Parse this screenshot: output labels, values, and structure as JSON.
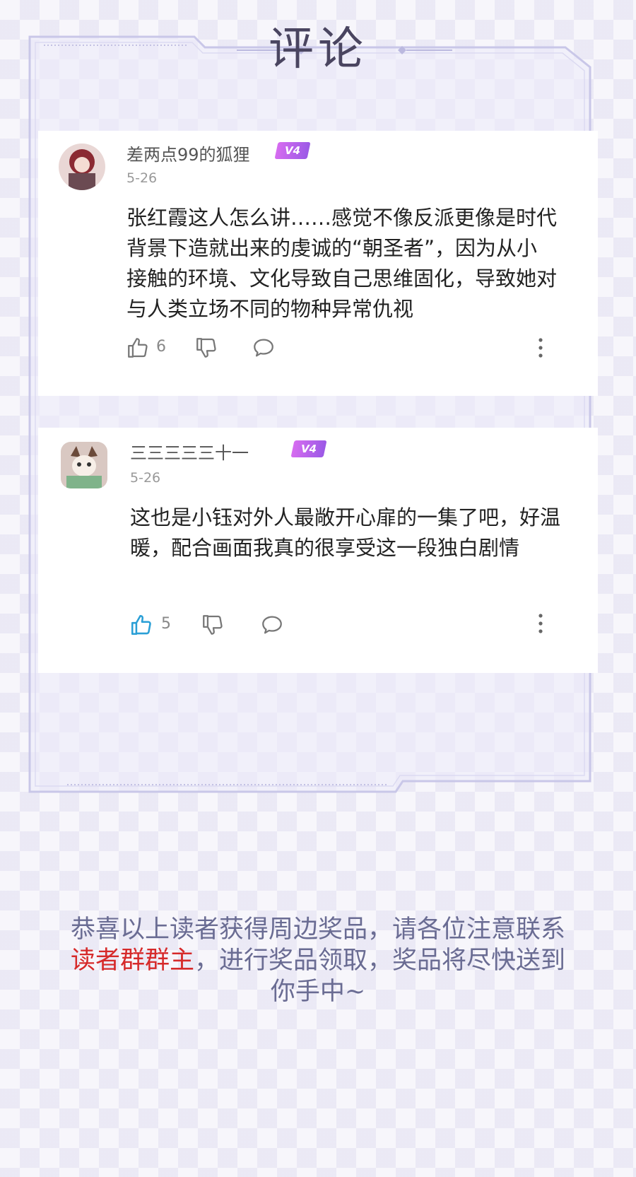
{
  "header": {
    "title": "评论"
  },
  "comments": [
    {
      "username": "差两点99的狐狸",
      "badge": "V4",
      "date": "5-26",
      "text": "张红霞这人怎么讲……感觉不像反派更像是时代背景下造就出来的虔诚的“朝圣者”，因为从小接触的环境、文化导致自己思维固化，导致她对与人类立场不同的物种异常仇视",
      "likes": "6",
      "liked": false
    },
    {
      "username": "三三三三三十一",
      "badge": "V4",
      "date": "5-26",
      "text": "这也是小钰对外人最敞开心扉的一集了吧，好温暖，配合画面我真的很享受这一段独白剧情",
      "likes": "5",
      "liked": true
    }
  ],
  "notice": {
    "part1": "恭喜以上读者获得周边奖品，请各位注意联系",
    "highlight": "读者群群主",
    "part2": "，进行奖品领取，奖品将尽快送到你手中~"
  },
  "colors": {
    "accent": "#d62a2a",
    "badge": "#b560ea",
    "like_active": "#2a9fd6",
    "notice_text": "#6a6c93"
  },
  "icons": [
    "thumbs-up-icon",
    "thumbs-down-icon",
    "comment-icon",
    "more-vertical-icon"
  ]
}
